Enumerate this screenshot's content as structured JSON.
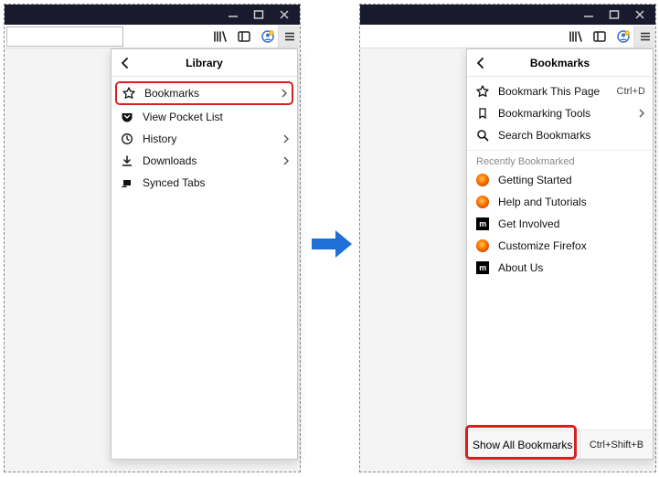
{
  "left": {
    "panel_title": "Library",
    "items": [
      {
        "label": "Bookmarks",
        "chev": true,
        "highlight": true
      },
      {
        "label": "View Pocket List",
        "chev": false,
        "highlight": false
      },
      {
        "label": "History",
        "chev": true,
        "highlight": false
      },
      {
        "label": "Downloads",
        "chev": true,
        "highlight": false
      },
      {
        "label": "Synced Tabs",
        "chev": false,
        "highlight": false
      }
    ]
  },
  "right": {
    "panel_title": "Bookmarks",
    "top_items": [
      {
        "label": "Bookmark This Page",
        "right": "Ctrl+D"
      },
      {
        "label": "Bookmarking Tools",
        "right": "›"
      },
      {
        "label": "Search Bookmarks",
        "right": ""
      }
    ],
    "recent_header": "Recently Bookmarked",
    "recent": [
      {
        "label": "Getting Started"
      },
      {
        "label": "Help and Tutorials"
      },
      {
        "label": "Get Involved"
      },
      {
        "label": "Customize Firefox"
      },
      {
        "label": "About Us"
      }
    ],
    "footer": {
      "label": "Show All Bookmarks",
      "shortcut": "Ctrl+Shift+B"
    }
  },
  "icons": {
    "mdn": "m"
  }
}
